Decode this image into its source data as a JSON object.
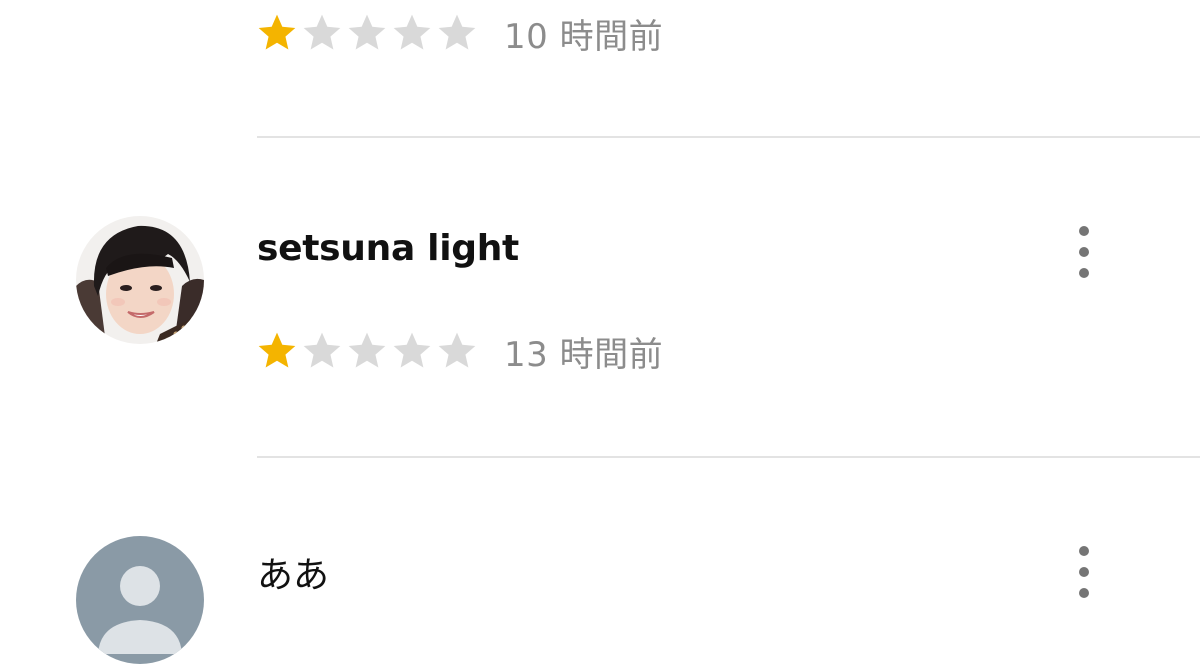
{
  "colors": {
    "star_filled": "#F4B400",
    "star_empty": "#D9D9D9",
    "divider": "#E3E3E3",
    "menu_dots": "#757575",
    "placeholder_avatar": "#8A9AA6"
  },
  "reviews": [
    {
      "author": "",
      "rating": 1,
      "max_rating": 5,
      "time": "10 時間前",
      "avatar": "partially-hidden"
    },
    {
      "author": "setsuna light",
      "rating": 1,
      "max_rating": 5,
      "time": "13 時間前",
      "avatar": "photo"
    },
    {
      "author": "ああ",
      "avatar": "default-person-icon"
    }
  ],
  "icons": {
    "menu": "more-vert-icon",
    "star": "star-icon"
  }
}
